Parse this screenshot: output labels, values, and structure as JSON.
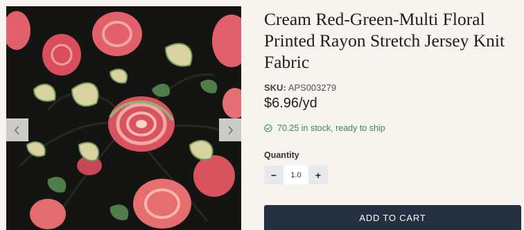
{
  "product": {
    "title": "Cream Red-Green-Multi Floral Printed Rayon Stretch Jersey Knit Fabric",
    "sku_label": "SKU:",
    "sku_value": "APS003279",
    "price": "$6.96/yd",
    "stock_text": "70.25 in stock, ready to ship",
    "quantity_label": "Quantity",
    "quantity_value": "1.0",
    "decrement_label": "−",
    "increment_label": "+",
    "add_to_cart_label": "ADD TO CART"
  },
  "gallery": {
    "prev_icon": "chevron-left-icon",
    "next_icon": "chevron-right-icon"
  },
  "colors": {
    "background": "#f7f3ef",
    "stock_green": "#3a8a4a",
    "cart_button": "#243040",
    "fabric_base": "#141412",
    "flower_pink": "#e2606c",
    "leaf_cream": "#d8d3a0"
  }
}
